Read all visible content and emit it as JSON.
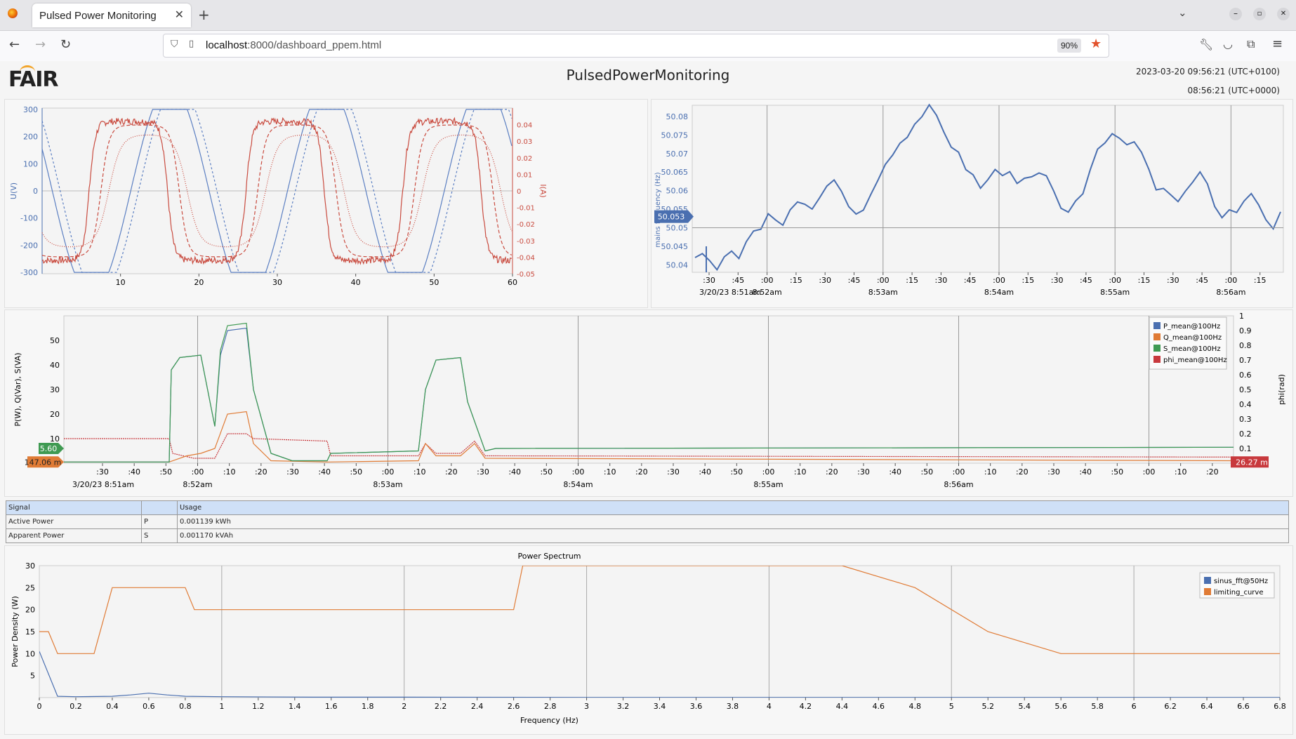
{
  "browser": {
    "tab_title": "Pulsed Power Monitoring",
    "url_host": "localhost",
    "url_rest": ":8000/dashboard_ppem.html",
    "zoom": "90%"
  },
  "page": {
    "logo": "FAIR",
    "title": "PulsedPowerMonitoring",
    "time_local": "2023-03-20 09:56:21 (UTC+0100)",
    "time_utc": "08:56:21 (UTC+0000)"
  },
  "chart_data": [
    {
      "type": "line",
      "name_ref": "voltage-current",
      "ylabel": "U(V)",
      "y2label": "I(A)",
      "x_ticks": [
        "10",
        "20",
        "30",
        "40",
        "50",
        "60"
      ],
      "y_ticks": [
        "300",
        "200",
        "100",
        "0",
        "-100",
        "-200",
        "-300"
      ],
      "y2_ticks": [
        "0.04",
        "0.03",
        "0.02",
        "0.01",
        "0",
        "-0.01",
        "-0.02",
        "-0.03",
        "-0.04",
        "-0.05"
      ],
      "xlim": [
        0,
        60
      ],
      "ylim": [
        -305,
        305
      ],
      "y2lim": [
        -0.05,
        0.05
      ],
      "voltage_amplitude": 300,
      "voltage_period": 20,
      "current_amplitude": 0.045,
      "colors": {
        "voltage": "#5b7fc2",
        "current": "#c94b3f"
      }
    },
    {
      "type": "line",
      "name_ref": "mains-frequency",
      "ylabel": "mains frequency (Hz)",
      "y_ticks": [
        "50.08",
        "50.075",
        "50.07",
        "50.065",
        "50.06",
        "50.055",
        "50.05",
        "50.045",
        "50.04"
      ],
      "ylim": [
        50.038,
        50.083
      ],
      "current_value_label": "50.053",
      "x_ticks": [
        ":30",
        ":45",
        ":00",
        ":15",
        ":30",
        ":45",
        ":00",
        ":15",
        ":30",
        ":45",
        ":00",
        ":15",
        ":30",
        ":45",
        ":00",
        ":15",
        ":30",
        ":45",
        ":00",
        ":15"
      ],
      "x_major_labels": [
        "3/20/23 8:51am",
        "8:52am",
        "8:53am",
        "8:54am",
        "8:55am",
        "8:56am"
      ],
      "values": [
        50.042,
        50.043,
        50.041,
        50.039,
        50.042,
        50.044,
        50.042,
        50.046,
        50.049,
        50.05,
        50.054,
        50.052,
        50.051,
        50.055,
        50.057,
        50.056,
        50.055,
        50.058,
        50.061,
        50.063,
        50.06,
        50.056,
        50.054,
        50.055,
        50.059,
        50.063,
        50.067,
        50.07,
        50.073,
        50.074,
        50.078,
        50.08,
        50.083,
        50.08,
        50.076,
        50.072,
        50.07,
        50.066,
        50.064,
        50.061,
        50.063,
        50.066,
        50.064,
        50.065,
        50.062,
        50.063,
        50.064,
        50.065,
        50.064,
        50.06,
        50.055,
        50.054,
        50.057,
        50.059,
        50.066,
        50.071,
        50.073,
        50.075,
        50.074,
        50.072,
        50.073,
        50.07,
        50.066,
        50.06,
        50.061,
        50.059,
        50.057,
        50.06,
        50.062,
        50.065,
        50.062,
        50.056,
        50.053,
        50.055,
        50.054,
        50.057,
        50.059,
        50.056,
        50.052,
        50.05,
        50.054
      ],
      "color": "#4a6fb0"
    },
    {
      "type": "line",
      "name_ref": "power",
      "ylabel": "P(W), Q(Var), S(VA)",
      "y2label": "phi(rad)",
      "y_ticks": [
        "50",
        "40",
        "30",
        "20",
        "10"
      ],
      "y2_ticks": [
        "1",
        "0.9",
        "0.8",
        "0.7",
        "0.6",
        "0.5",
        "0.4",
        "0.3",
        "0.2",
        "0.1"
      ],
      "ylim": [
        0,
        60
      ],
      "y2lim": [
        0,
        1
      ],
      "x_ticks": [
        ":30",
        ":40",
        ":50",
        ":00",
        ":10",
        ":20",
        ":30",
        ":40",
        ":50",
        ":00",
        ":10",
        ":20",
        ":30",
        ":40",
        ":50",
        ":00",
        ":10",
        ":20",
        ":30",
        ":40",
        ":50",
        ":00",
        ":10",
        ":20",
        ":30",
        ":40",
        ":50",
        ":00",
        ":10",
        ":20",
        ":30",
        ":40",
        ":50",
        ":00",
        ":10",
        ":20"
      ],
      "x_major_labels": [
        "3/20/23 8:51am",
        "8:52am",
        "8:53am",
        "8:54am",
        "8:55am",
        "8:56am"
      ],
      "left_labels": [
        {
          "text": "5.60",
          "color": "#3f9a52"
        },
        {
          "text": "147.06 m",
          "color": "#e07b35"
        }
      ],
      "right_label": {
        "text": "26.27 m",
        "color": "#c8393d"
      },
      "series": [
        {
          "name": "P_mean@100Hz",
          "color": "#4a6fb0"
        },
        {
          "name": "Q_mean@100Hz",
          "color": "#e07b35"
        },
        {
          "name": "S_mean@100Hz",
          "color": "#3f9a52"
        },
        {
          "name": "phi_mean@100Hz",
          "color": "#c8393d"
        }
      ]
    },
    {
      "type": "line",
      "name_ref": "power-spectrum",
      "title": "Power Spectrum",
      "xlabel": "Frequency (Hz)",
      "ylabel": "Power Density (W)",
      "xlim": [
        0,
        6.8
      ],
      "ylim": [
        0,
        30
      ],
      "x_ticks": [
        "0",
        "0.2",
        "0.4",
        "0.6",
        "0.8",
        "1",
        "1.2",
        "1.4",
        "1.6",
        "1.8",
        "2",
        "2.2",
        "2.4",
        "2.6",
        "2.8",
        "3",
        "3.2",
        "3.4",
        "3.6",
        "3.8",
        "4",
        "4.2",
        "4.4",
        "4.6",
        "4.8",
        "5",
        "5.2",
        "5.4",
        "5.6",
        "5.8",
        "6",
        "6.2",
        "6.4",
        "6.6",
        "6.8"
      ],
      "y_ticks": [
        "30",
        "25",
        "20",
        "15",
        "10",
        "5"
      ],
      "series": [
        {
          "name": "sinus_fft@50Hz",
          "color": "#4a6fb0",
          "x": [
            0,
            0.1,
            0.2,
            0.4,
            0.5,
            0.6,
            0.7,
            0.8,
            1,
            1.5,
            2,
            3,
            6.8
          ],
          "y": [
            10.5,
            0.3,
            0.2,
            0.3,
            0.6,
            1.0,
            0.6,
            0.3,
            0.2,
            0.1,
            0.1,
            0.05,
            0.05
          ]
        },
        {
          "name": "limiting_curve",
          "color": "#e07b35",
          "x": [
            0,
            0.05,
            0.1,
            0.3,
            0.4,
            0.8,
            0.85,
            2.6,
            2.65,
            4.4,
            4.8,
            5.2,
            5.6,
            6.8
          ],
          "y": [
            15,
            15,
            10,
            10,
            25,
            25,
            20,
            20,
            30,
            30,
            25,
            15,
            10,
            10
          ]
        }
      ]
    }
  ],
  "usage_table": {
    "headers": [
      "Signal",
      "",
      "Usage"
    ],
    "rows": [
      [
        "Active Power",
        "P",
        "0.001139 kWh"
      ],
      [
        "Apparent Power",
        "S",
        "0.001170 kVAh"
      ]
    ]
  }
}
